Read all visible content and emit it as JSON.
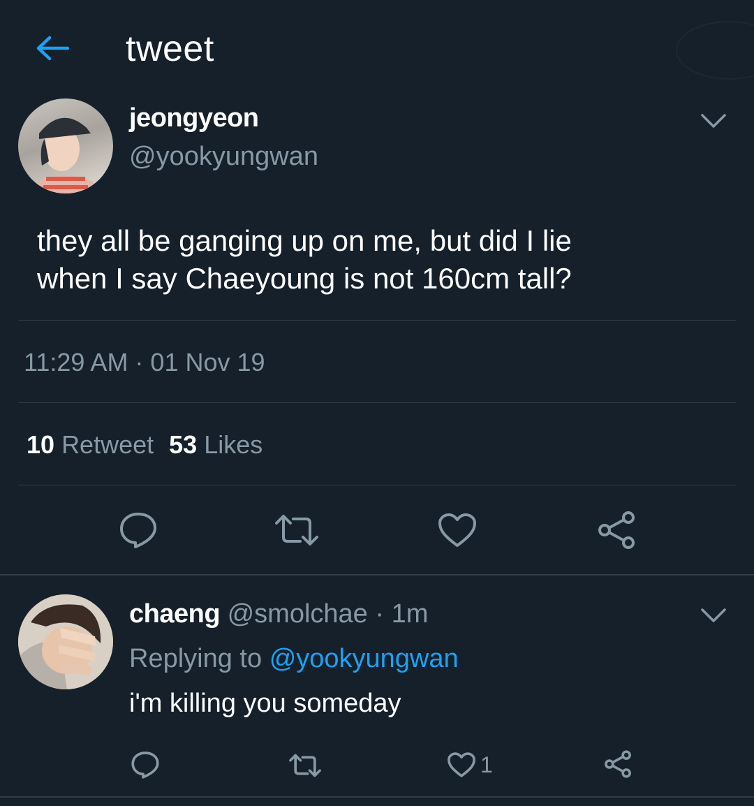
{
  "header": {
    "title": "tweet",
    "back_icon": "back-arrow-icon"
  },
  "tweet": {
    "display_name": "jeongyeon",
    "handle": "@yookyungwan",
    "text_line1": "they all be ganging up on me, but did I lie",
    "text_line2": "when I say Chaeyoung is not 160cm tall?",
    "timestamp": "11:29 AM · 01 Nov 19",
    "retweet_count": "10",
    "retweet_label": "Retweet",
    "like_count": "53",
    "like_label": "Likes"
  },
  "reply": {
    "display_name": "chaeng",
    "handle_time": "@smolchae · 1m",
    "replying_prefix": "Replying to",
    "replying_mention": "@yookyungwan",
    "text": "i'm killing you someday",
    "like_count": "1"
  },
  "colors": {
    "background": "#15202b",
    "accent": "#1da1f2",
    "secondary_text": "#8899a6",
    "divider": "#2f3d4a"
  }
}
